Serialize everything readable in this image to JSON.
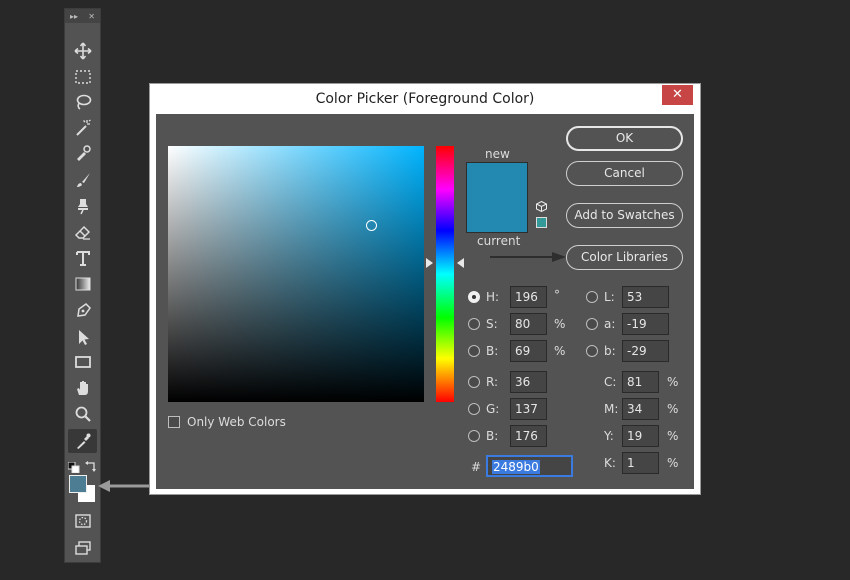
{
  "toolbar": {
    "header_left": "▸▸",
    "header_right": "✕",
    "tools": [
      "move-tool",
      "marquee-tool",
      "lasso-tool",
      "quick-selection-tool",
      "eyedropper-tool",
      "brush-tool",
      "clone-stamp-tool",
      "eraser-tool",
      "type-tool",
      "gradient-tool",
      "pen-tool",
      "path-selection-tool",
      "rectangle-tool",
      "hand-tool",
      "zoom-tool",
      "color-sampler-tool"
    ],
    "foreground_color": "#4d7d92",
    "background_color": "#ffffff"
  },
  "dialog": {
    "title": "Color Picker (Foreground Color)",
    "close_label": "✕",
    "new_label": "new",
    "current_label": "current",
    "new_color": "#2489b0",
    "current_color": "#2489b0",
    "websafe_color": "#339999",
    "buttons": {
      "ok": "OK",
      "cancel": "Cancel",
      "add_to_swatches": "Add to Swatches",
      "color_libraries": "Color Libraries"
    },
    "only_web_colors": "Only Web Colors",
    "hsb": {
      "h_label": "H:",
      "h_value": "196",
      "h_unit": "°",
      "s_label": "S:",
      "s_value": "80",
      "s_unit": "%",
      "b_label": "B:",
      "b_value": "69",
      "b_unit": "%"
    },
    "rgb": {
      "r_label": "R:",
      "r_value": "36",
      "g_label": "G:",
      "g_value": "137",
      "b_label": "B:",
      "b_value": "176"
    },
    "lab": {
      "l_label": "L:",
      "l_value": "53",
      "a_label": "a:",
      "a_value": "-19",
      "b_label": "b:",
      "b_value": "-29"
    },
    "cmyk": {
      "c_label": "C:",
      "c_value": "81",
      "c_unit": "%",
      "m_label": "M:",
      "m_value": "34",
      "m_unit": "%",
      "y_label": "Y:",
      "y_value": "19",
      "y_unit": "%",
      "k_label": "K:",
      "k_value": "1",
      "k_unit": "%"
    },
    "hex_label": "#",
    "hex_value": "2489b0"
  }
}
